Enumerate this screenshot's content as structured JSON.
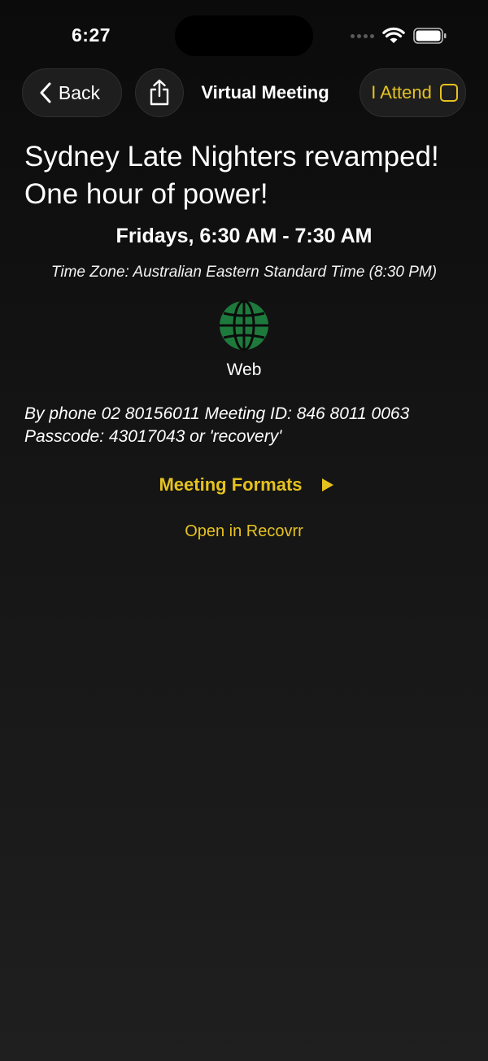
{
  "status_bar": {
    "time": "6:27"
  },
  "nav": {
    "back_label": "Back",
    "title": "Virtual Meeting",
    "attend_label": "I Attend"
  },
  "meeting": {
    "title": "Sydney Late Nighters revamped! One hour of power!",
    "schedule": "Fridays, 6:30 AM - 7:30 AM",
    "timezone": "Time Zone: Australian Eastern Standard Time (8:30 PM)",
    "venue_type": "Web",
    "phone_info": "By phone 02 80156011 Meeting ID: 846 8011 0063 Passcode: 43017043 or 'recovery'",
    "formats_label": "Meeting Formats",
    "open_link": "Open in Recovrr"
  },
  "icons": {
    "back": "chevron-left-icon",
    "share": "share-icon",
    "web": "globe-icon",
    "formats_toggle": "play-icon"
  },
  "colors": {
    "accent": "#e6c21f",
    "globe": "#1e7a3c",
    "background": "#141414"
  }
}
